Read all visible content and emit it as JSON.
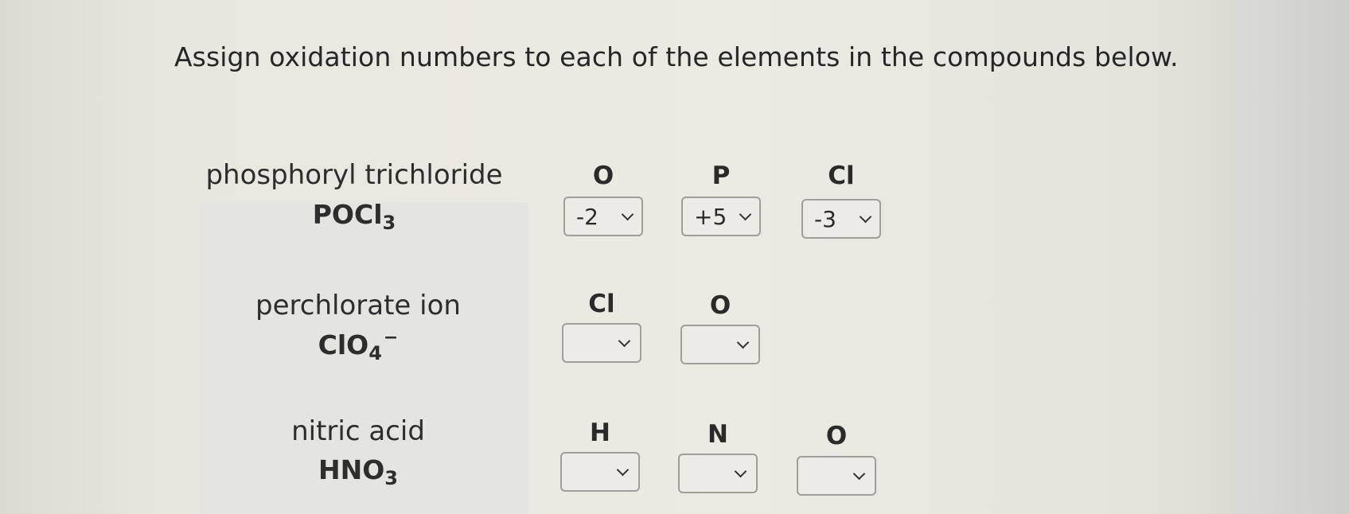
{
  "instructions": "Assign oxidation numbers to each of the elements in the compounds below.",
  "compounds": [
    {
      "name": "phosphoryl trichloride",
      "formula_main": "POCl",
      "formula_sub": "3",
      "elements": [
        {
          "symbol": "O",
          "selected": "-2"
        },
        {
          "symbol": "P",
          "selected": "+5"
        },
        {
          "symbol": "Cl",
          "selected": "-3"
        }
      ]
    },
    {
      "name": "perchlorate ion",
      "formula_main": "ClO",
      "formula_sub": "4",
      "formula_sup": "−",
      "elements": [
        {
          "symbol": "Cl",
          "selected": ""
        },
        {
          "symbol": "O",
          "selected": ""
        }
      ]
    },
    {
      "name": "nitric acid",
      "formula_main": "HNO",
      "formula_sub": "3",
      "elements": [
        {
          "symbol": "H",
          "selected": ""
        },
        {
          "symbol": "N",
          "selected": ""
        },
        {
          "symbol": "O",
          "selected": ""
        }
      ]
    }
  ],
  "icons": {
    "dropdown": "chevron-down-icon"
  }
}
